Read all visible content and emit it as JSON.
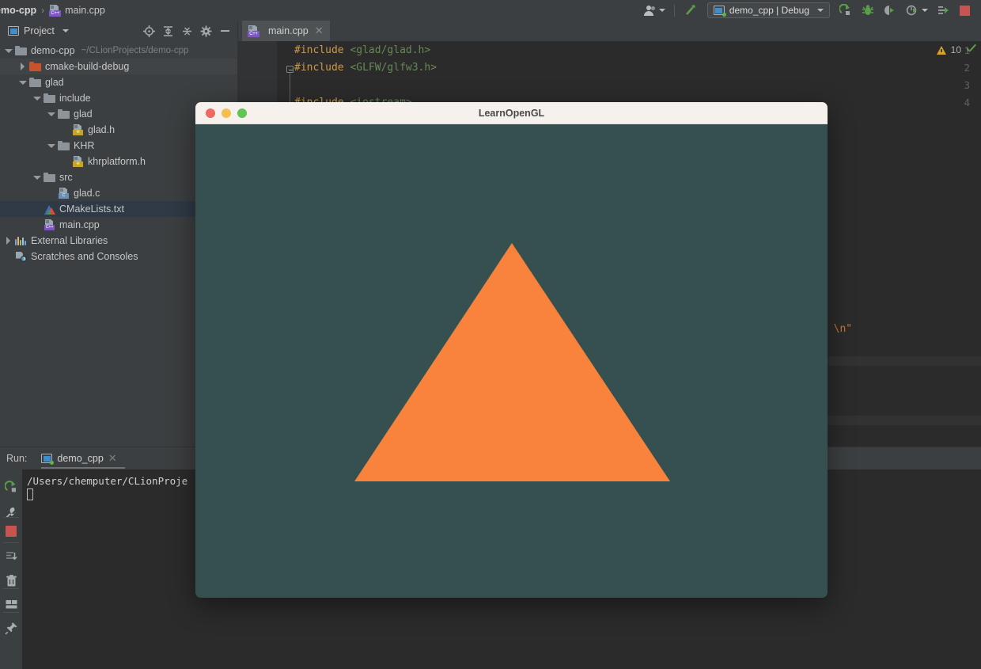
{
  "breadcrumb": {
    "project": "emo-cpp",
    "separator": "›",
    "file": "main.cpp",
    "file_badge": "C++"
  },
  "toolbar": {
    "user_icon": "users-icon",
    "hammer_icon": "build-hammer-icon",
    "run_config": "demo_cpp | Debug",
    "buttons": [
      {
        "name": "run-button",
        "icon": "run-arrow-icon"
      },
      {
        "name": "debug-button",
        "icon": "bug-icon"
      },
      {
        "name": "run-with-coverage-button",
        "icon": "coverage-icon"
      },
      {
        "name": "profile-button",
        "icon": "profiler-icon"
      },
      {
        "name": "attach-to-process-button",
        "icon": "attach-icon"
      },
      {
        "name": "stop-button",
        "icon": "stop-square-icon"
      }
    ]
  },
  "project_panel": {
    "title": "Project",
    "icon": "project-window-icon",
    "dropdown_icon": "chevron-down-icon",
    "tools": [
      {
        "name": "locate-button",
        "icon": "crosshair-target-icon"
      },
      {
        "name": "expand-all-button",
        "icon": "expand-all-icon"
      },
      {
        "name": "collapse-all-button",
        "icon": "collapse-all-icon"
      },
      {
        "name": "settings-button",
        "icon": "gear-icon"
      },
      {
        "name": "hide-panel-button",
        "icon": "minimize-icon"
      }
    ]
  },
  "tree": [
    {
      "label": "demo-cpp",
      "path": "~/CLionProjects/demo-cpp",
      "indent": 0,
      "arrow": "down",
      "icon": "folder-gray",
      "state": "normal"
    },
    {
      "label": "cmake-build-debug",
      "path": "",
      "indent": 1,
      "arrow": "right",
      "icon": "folder-orange",
      "state": "hover"
    },
    {
      "label": "glad",
      "path": "",
      "indent": 1,
      "arrow": "down",
      "icon": "folder-gray",
      "state": "normal"
    },
    {
      "label": "include",
      "path": "",
      "indent": 2,
      "arrow": "down",
      "icon": "folder-gray",
      "state": "normal"
    },
    {
      "label": "glad",
      "path": "",
      "indent": 3,
      "arrow": "down",
      "icon": "folder-gray",
      "state": "normal"
    },
    {
      "label": "glad.h",
      "path": "",
      "indent": 4,
      "arrow": "none",
      "icon": "file-h",
      "state": "normal"
    },
    {
      "label": "KHR",
      "path": "",
      "indent": 3,
      "arrow": "down",
      "icon": "folder-gray",
      "state": "normal"
    },
    {
      "label": "khrplatform.h",
      "path": "",
      "indent": 4,
      "arrow": "none",
      "icon": "file-h",
      "state": "normal"
    },
    {
      "label": "src",
      "path": "",
      "indent": 2,
      "arrow": "down",
      "icon": "folder-gray",
      "state": "normal"
    },
    {
      "label": "glad.c",
      "path": "",
      "indent": 3,
      "arrow": "none",
      "icon": "file-c",
      "state": "normal"
    },
    {
      "label": "CMakeLists.txt",
      "path": "",
      "indent": 2,
      "arrow": "none",
      "icon": "cmake",
      "state": "selected"
    },
    {
      "label": "main.cpp",
      "path": "",
      "indent": 2,
      "arrow": "none",
      "icon": "file-cpp",
      "state": "normal"
    },
    {
      "label": "External Libraries",
      "path": "",
      "indent": 0,
      "arrow": "right",
      "icon": "library",
      "state": "normal"
    },
    {
      "label": "Scratches and Consoles",
      "path": "",
      "indent": 0,
      "arrow": "none",
      "icon": "scratch",
      "state": "normal"
    }
  ],
  "editor": {
    "tab": {
      "label": "main.cpp",
      "badge": "C++",
      "close_icon": "close-icon"
    },
    "lines": [
      {
        "num": "1",
        "parts": [
          {
            "t": "#include ",
            "c": "kw"
          },
          {
            "t": "<glad/glad.h>",
            "c": "str"
          }
        ]
      },
      {
        "num": "2",
        "parts": [
          {
            "t": "#include ",
            "c": "kw"
          },
          {
            "t": "<GLFW/glfw3.h>",
            "c": "str"
          }
        ]
      },
      {
        "num": "3",
        "parts": []
      },
      {
        "num": "4",
        "parts": [
          {
            "t": "#include ",
            "c": "kw"
          },
          {
            "t": "<iostream>",
            "c": "str"
          }
        ]
      }
    ],
    "fragment_right": [
      {
        "t": "; ",
        "c": "str"
      },
      {
        "t": "\\n\"",
        "c": "esc"
      }
    ],
    "inspection": {
      "warning_icon": "warning-triangle-icon",
      "warning_count": "10",
      "ok_icon": "checkmark-icon"
    }
  },
  "run_panel": {
    "label": "Run:",
    "tab": {
      "name": "demo_cpp",
      "icon": "run-config-icon",
      "close_icon": "close-icon"
    },
    "gutter": [
      {
        "name": "rerun-button",
        "icon": "rerun-arrow-icon"
      },
      {
        "name": "edit-configurations-button",
        "icon": "wrench-icon"
      },
      {
        "name": "stop-button",
        "icon": "stop-square-icon"
      },
      {
        "name": "scroll-to-end-button",
        "icon": "scroll-to-end-icon"
      },
      {
        "name": "clear-all-button",
        "icon": "trash-icon"
      },
      {
        "name": "layout-button",
        "icon": "layout-grid-icon"
      },
      {
        "name": "pin-tab-button",
        "icon": "pin-icon"
      }
    ],
    "console_lines": [
      "/Users/chemputer/CLionProje"
    ]
  },
  "gl_window": {
    "title": "LearnOpenGL",
    "traffic_lights": [
      {
        "name": "close-window-button",
        "color": "#ec6a5e"
      },
      {
        "name": "minimize-window-button",
        "color": "#f4bf4f"
      },
      {
        "name": "maximize-window-button",
        "color": "#61c554"
      }
    ],
    "canvas": {
      "background_color": "#36504f",
      "triangle_color": "#f9833c",
      "triangle_apex": "647,307",
      "triangle_left": "448,608",
      "triangle_right": "847,608"
    }
  },
  "colors": {
    "ide_chrome": "#3c3f41",
    "editor_bg": "#2b2b2b",
    "selection": "#2f3a46",
    "accent_green": "#62b543",
    "warning": "#d9a520",
    "gl_bg": "#36504f",
    "gl_triangle": "#f9833c"
  }
}
